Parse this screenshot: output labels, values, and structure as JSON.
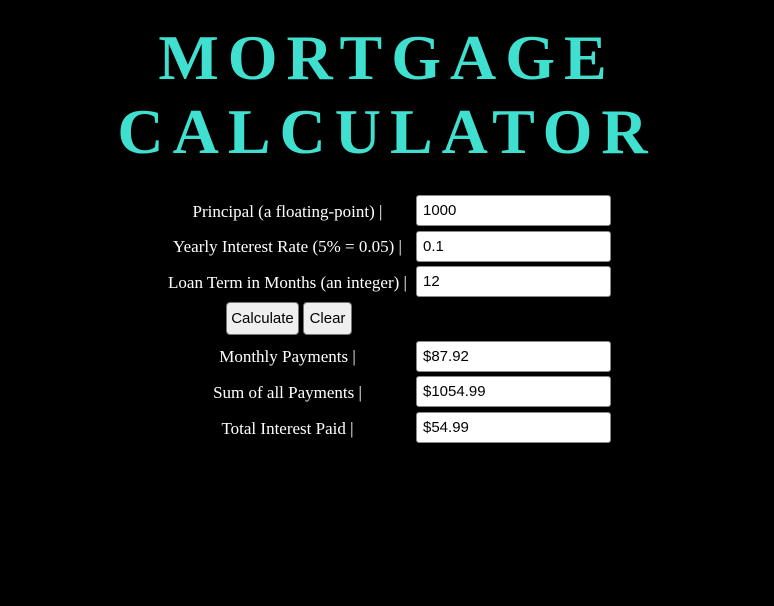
{
  "title": {
    "line1": "MORTGAGE",
    "line2": "CALCULATOR",
    "color": "#40E0D0"
  },
  "inputs": {
    "principal": {
      "label": "Principal (a floating-point) |",
      "value": "1000"
    },
    "rate": {
      "label": "Yearly Interest Rate (5% = 0.05) |",
      "value": "0.1"
    },
    "term": {
      "label": "Loan Term in Months (an integer) |",
      "value": "12"
    }
  },
  "buttons": {
    "calculate": "Calculate",
    "clear": "Clear"
  },
  "results": {
    "monthly": {
      "label": "Monthly Payments |",
      "value": "$87.92"
    },
    "sum": {
      "label": "Sum of all Payments |",
      "value": "$1054.99"
    },
    "interest": {
      "label": "Total Interest Paid |",
      "value": "$54.99"
    }
  }
}
